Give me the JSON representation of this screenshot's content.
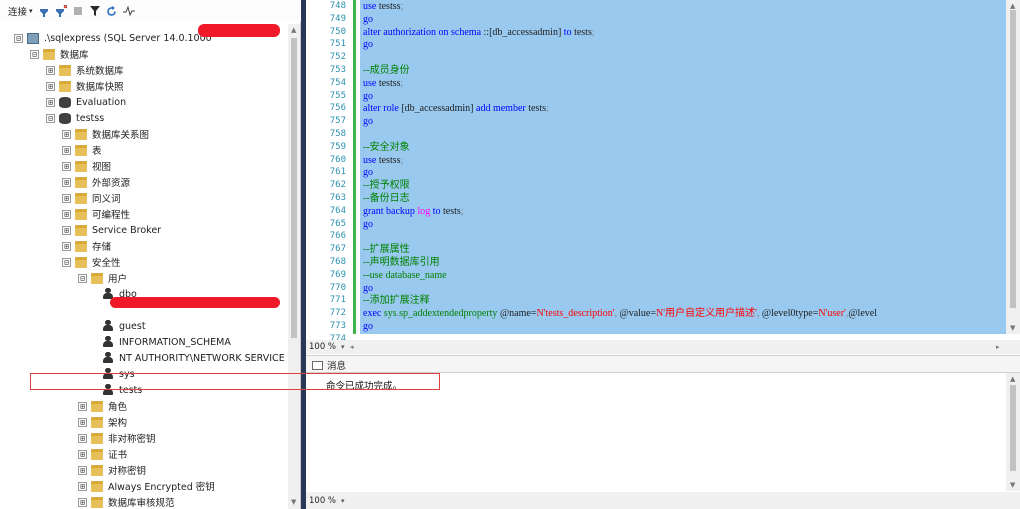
{
  "explorer": {
    "toolbar": {
      "connect_label": "连接",
      "connect_caret": "▾"
    },
    "tree": [
      {
        "label": ".\\sqlexpress (SQL Server 14.0.1000",
        "icon": "server-icon",
        "expander": "⊟"
      },
      {
        "label": "数据库",
        "icon": "folder-icon",
        "expander": "⊟"
      },
      {
        "label": "系统数据库",
        "icon": "folder-icon",
        "expander": "⊞"
      },
      {
        "label": "数据库快照",
        "icon": "folder-icon",
        "expander": "⊞"
      },
      {
        "label": "Evaluation",
        "icon": "database-icon",
        "expander": "⊞"
      },
      {
        "label": "testss",
        "icon": "database-icon",
        "expander": "⊟"
      },
      {
        "label": "数据库关系图",
        "icon": "folder-icon",
        "expander": "⊞"
      },
      {
        "label": "表",
        "icon": "folder-icon",
        "expander": "⊞"
      },
      {
        "label": "视图",
        "icon": "folder-icon",
        "expander": "⊞"
      },
      {
        "label": "外部资源",
        "icon": "folder-icon",
        "expander": "⊞"
      },
      {
        "label": "同义词",
        "icon": "folder-icon",
        "expander": "⊞"
      },
      {
        "label": "可编程性",
        "icon": "folder-icon",
        "expander": "⊞"
      },
      {
        "label": "Service Broker",
        "icon": "folder-icon",
        "expander": "⊞"
      },
      {
        "label": "存储",
        "icon": "folder-icon",
        "expander": "⊞"
      },
      {
        "label": "安全性",
        "icon": "folder-icon",
        "expander": "⊟"
      },
      {
        "label": "用户",
        "icon": "folder-icon",
        "expander": "⊟"
      },
      {
        "label": "dbo",
        "icon": "user-icon",
        "expander": ""
      },
      {
        "label": "guest",
        "icon": "user-icon",
        "expander": ""
      },
      {
        "label": "INFORMATION_SCHEMA",
        "icon": "user-icon",
        "expander": ""
      },
      {
        "label": "NT AUTHORITY\\NETWORK SERVICE",
        "icon": "user-icon",
        "expander": ""
      },
      {
        "label": "sys",
        "icon": "user-icon",
        "expander": ""
      },
      {
        "label": "tests",
        "icon": "user-icon",
        "expander": ""
      },
      {
        "label": "角色",
        "icon": "folder-icon",
        "expander": "⊞"
      },
      {
        "label": "架构",
        "icon": "folder-icon",
        "expander": "⊞"
      },
      {
        "label": "非对称密钥",
        "icon": "folder-icon",
        "expander": "⊞"
      },
      {
        "label": "证书",
        "icon": "folder-icon",
        "expander": "⊞"
      },
      {
        "label": "对称密钥",
        "icon": "folder-icon",
        "expander": "⊞"
      },
      {
        "label": "Always Encrypted 密钥",
        "icon": "folder-icon",
        "expander": "⊞"
      },
      {
        "label": "数据库审核规范",
        "icon": "folder-icon",
        "expander": "⊞"
      }
    ]
  },
  "editor": {
    "lines": [
      {
        "num": "748",
        "tokens": [
          [
            "kw",
            "use"
          ],
          [
            "tx",
            " testss"
          ],
          [
            "gr",
            ";"
          ]
        ]
      },
      {
        "num": "749",
        "tokens": [
          [
            "kw",
            "go"
          ]
        ]
      },
      {
        "num": "750",
        "tokens": [
          [
            "kw",
            "alter authorization on schema"
          ],
          [
            "tx",
            " ::"
          ],
          [
            "tx",
            "[db_accessadmin]"
          ],
          [
            "kw",
            " to"
          ],
          [
            "tx",
            " tests"
          ],
          [
            "gr",
            ";"
          ]
        ]
      },
      {
        "num": "751",
        "tokens": [
          [
            "kw",
            "go"
          ]
        ]
      },
      {
        "num": "752",
        "tokens": []
      },
      {
        "num": "753",
        "tokens": [
          [
            "cm",
            "--成员身份"
          ]
        ]
      },
      {
        "num": "754",
        "tokens": [
          [
            "kw",
            "use"
          ],
          [
            "tx",
            " testss"
          ],
          [
            "gr",
            ";"
          ]
        ]
      },
      {
        "num": "755",
        "tokens": [
          [
            "kw",
            "go"
          ]
        ]
      },
      {
        "num": "756",
        "tokens": [
          [
            "kw",
            "alter role"
          ],
          [
            "tx",
            " [db_accessadmin] "
          ],
          [
            "kw",
            "add member"
          ],
          [
            "tx",
            " tests"
          ],
          [
            "gr",
            ";"
          ]
        ]
      },
      {
        "num": "757",
        "tokens": [
          [
            "kw",
            "go"
          ]
        ]
      },
      {
        "num": "758",
        "tokens": []
      },
      {
        "num": "759",
        "tokens": [
          [
            "cm",
            "--安全对象"
          ]
        ]
      },
      {
        "num": "760",
        "tokens": [
          [
            "kw",
            "use"
          ],
          [
            "tx",
            " testss"
          ],
          [
            "gr",
            ";"
          ]
        ]
      },
      {
        "num": "761",
        "tokens": [
          [
            "kw",
            "go"
          ]
        ]
      },
      {
        "num": "762",
        "tokens": [
          [
            "cm",
            "--授予权限"
          ]
        ]
      },
      {
        "num": "763",
        "tokens": [
          [
            "cm",
            "--备份日志"
          ]
        ]
      },
      {
        "num": "764",
        "tokens": [
          [
            "kw",
            "grant backup"
          ],
          [
            "pk",
            " log"
          ],
          [
            "kw",
            " to"
          ],
          [
            "tx",
            " tests"
          ],
          [
            "gr",
            ";"
          ]
        ]
      },
      {
        "num": "765",
        "tokens": [
          [
            "kw",
            "go"
          ]
        ]
      },
      {
        "num": "766",
        "tokens": []
      },
      {
        "num": "767",
        "tokens": [
          [
            "cm",
            "--扩展属性"
          ]
        ]
      },
      {
        "num": "768",
        "tokens": [
          [
            "cm",
            "--声明数据库引用"
          ]
        ]
      },
      {
        "num": "769",
        "tokens": [
          [
            "cm",
            "--use database_name"
          ]
        ]
      },
      {
        "num": "770",
        "tokens": [
          [
            "kw",
            "go"
          ]
        ]
      },
      {
        "num": "771",
        "tokens": [
          [
            "cm",
            "--添加扩展注释"
          ]
        ]
      },
      {
        "num": "772",
        "tokens": [
          [
            "kw",
            "exec"
          ],
          [
            "cm",
            " sys"
          ],
          [
            "gr",
            "."
          ],
          [
            "cm",
            "sp_addextendedproperty"
          ],
          [
            "tx",
            " @name="
          ],
          [
            "st",
            "N'tests_description'"
          ],
          [
            "gr",
            ", "
          ],
          [
            "tx",
            "@value="
          ],
          [
            "st",
            "N'用户自定义用户描述'"
          ],
          [
            "gr",
            ", "
          ],
          [
            "tx",
            "@level0type="
          ],
          [
            "st",
            "N'user'"
          ],
          [
            "gr",
            ","
          ],
          [
            "tx",
            "@level"
          ]
        ]
      },
      {
        "num": "773",
        "tokens": [
          [
            "kw",
            "go"
          ]
        ]
      },
      {
        "num": "774",
        "tokens": []
      }
    ],
    "zoom": "100 %"
  },
  "results": {
    "tab_label": "消息",
    "message": "命令已成功完成。",
    "zoom": "100 %"
  },
  "colors": {
    "selection": "#99c9ef",
    "keyword": "#0000ff",
    "comment": "#008000",
    "string": "#ff0000",
    "splitter": "#293955",
    "annotation": "#e04040",
    "redaction": "#f0192a"
  }
}
